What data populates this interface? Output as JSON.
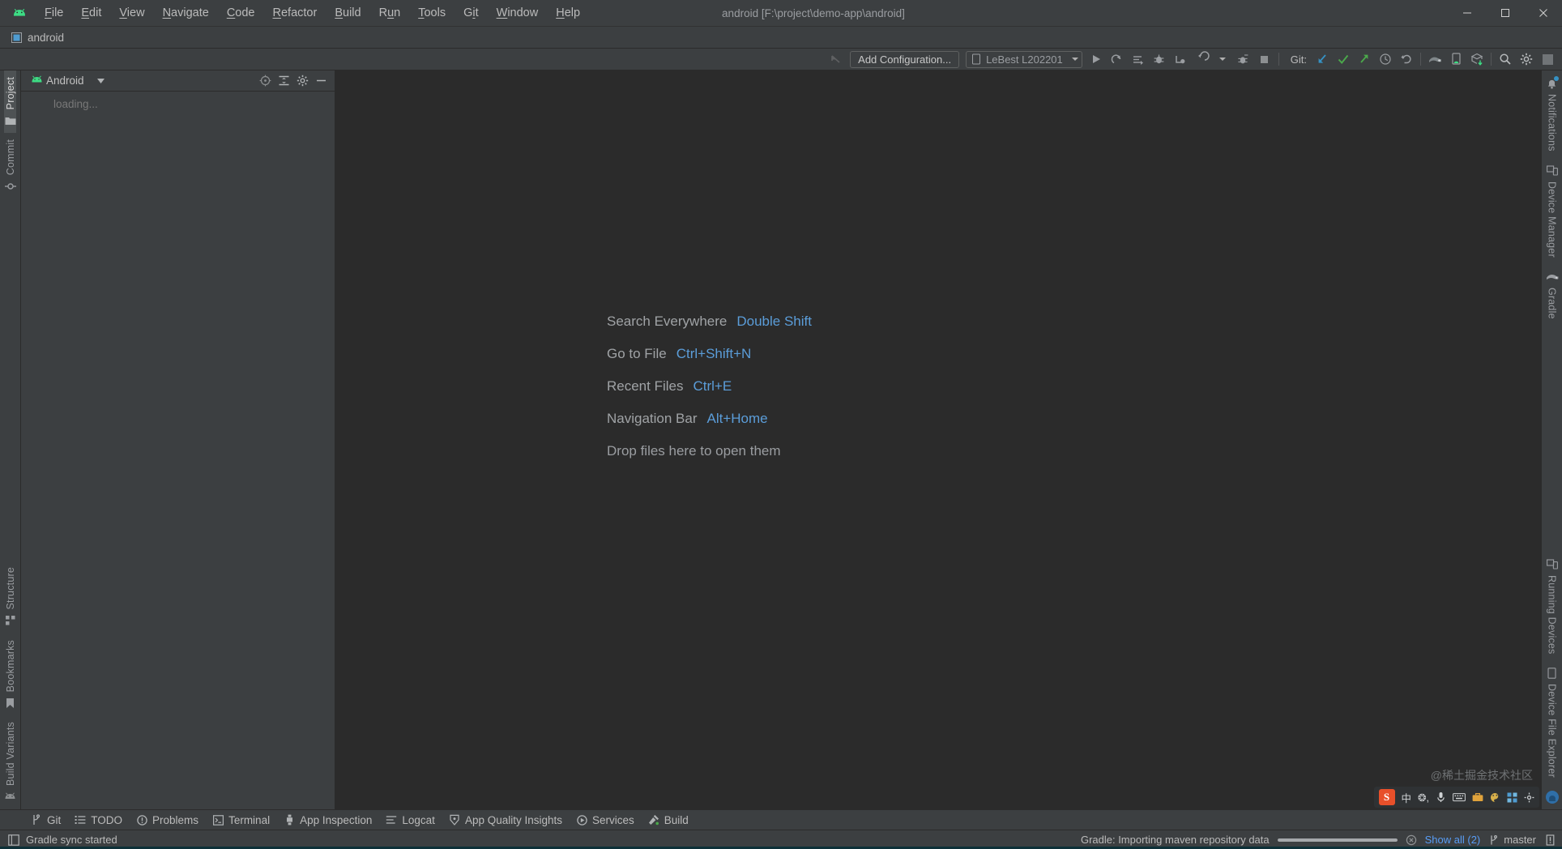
{
  "window": {
    "title": "android [F:\\project\\demo-app\\android]",
    "minimize_label": "─",
    "maximize_label": "❐",
    "close_label": "✕"
  },
  "menubar": {
    "items": [
      {
        "label": "File",
        "mnemonic": "F"
      },
      {
        "label": "Edit",
        "mnemonic": "E"
      },
      {
        "label": "View",
        "mnemonic": "V"
      },
      {
        "label": "Navigate",
        "mnemonic": "N"
      },
      {
        "label": "Code",
        "mnemonic": "C"
      },
      {
        "label": "Refactor",
        "mnemonic": "R"
      },
      {
        "label": "Build",
        "mnemonic": "B"
      },
      {
        "label": "Run",
        "mnemonic": "u"
      },
      {
        "label": "Tools",
        "mnemonic": "T"
      },
      {
        "label": "Git",
        "mnemonic": "i"
      },
      {
        "label": "Window",
        "mnemonic": "W"
      },
      {
        "label": "Help",
        "mnemonic": "H"
      }
    ]
  },
  "navbar": {
    "project_name": "android",
    "project_icon": "module-icon"
  },
  "toolbar": {
    "back_icon": "arrow-up-left-icon",
    "add_configuration": "Add Configuration...",
    "device": "LeBest L202201",
    "device_icon": "phone-icon",
    "git_label": "Git:",
    "run_icon": "run-icon",
    "rerun_icon": "rerun-icon",
    "apply_changes_icon": "apply-changes-icon",
    "debug_icon": "debug-icon",
    "attach_debugger_icon": "attach-debugger-icon",
    "profile_icon": "profiler-icon",
    "profile_dropdown_icon": "chevron-down-icon",
    "coverage_icon": "run-coverage-icon",
    "stop_icon": "stop-icon",
    "git_update_icon": "git-update-icon",
    "git_commit_icon": "git-commit-icon",
    "git_push_icon": "git-push-icon",
    "git_history_icon": "history-icon",
    "undo_icon": "undo-icon",
    "sync_gradle_icon": "gradle-sync-icon",
    "avd_manager_icon": "avd-manager-icon",
    "sdk_manager_icon": "sdk-manager-icon",
    "search_icon": "search-icon",
    "settings_icon": "gear-icon",
    "layout_icon": "layout-icon"
  },
  "left_strip": {
    "top": [
      {
        "label": "Project",
        "icon": "folder-icon",
        "active": true
      },
      {
        "label": "Commit",
        "icon": "commit-icon",
        "active": false
      }
    ],
    "bottom": [
      {
        "label": "Structure",
        "icon": "structure-icon"
      },
      {
        "label": "Bookmarks",
        "icon": "bookmark-icon"
      },
      {
        "label": "Build Variants",
        "icon": "android-icon"
      }
    ]
  },
  "right_strip": {
    "top": [
      {
        "label": "Notifications",
        "icon": "bell-icon",
        "badge": true
      },
      {
        "label": "Device Manager",
        "icon": "device-manager-icon"
      },
      {
        "label": "Gradle",
        "icon": "gradle-elephant-icon"
      }
    ],
    "bottom": [
      {
        "label": "Running Devices",
        "icon": "running-devices-icon"
      },
      {
        "label": "Device File Explorer",
        "icon": "device-file-icon"
      }
    ]
  },
  "project_panel": {
    "title": "Android",
    "title_icon": "android-icon",
    "dropdown_icon": "chevron-down-icon",
    "actions": [
      {
        "name": "select-opened-file-icon",
        "title": "Select Opened File"
      },
      {
        "name": "collapse-all-icon",
        "title": "Collapse All"
      },
      {
        "name": "gear-icon",
        "title": "Options"
      },
      {
        "name": "hide-icon",
        "title": "Hide"
      }
    ],
    "tree_status": "loading..."
  },
  "editor": {
    "hints": [
      {
        "label": "Search Everywhere",
        "key": "Double Shift"
      },
      {
        "label": "Go to File",
        "key": "Ctrl+Shift+N"
      },
      {
        "label": "Recent Files",
        "key": "Ctrl+E"
      },
      {
        "label": "Navigation Bar",
        "key": "Alt+Home"
      }
    ],
    "drop_hint": "Drop files here to open them"
  },
  "ime": {
    "logo_text": "S",
    "items": [
      "中",
      "❂,",
      "mic-icon",
      "keyboard-icon",
      "toolbox-icon",
      "palette-icon",
      "grid-icon",
      "gear-icon"
    ],
    "watermark": "@稀土掘金技术社区"
  },
  "bottom_bar": {
    "tabs": [
      {
        "label": "Git",
        "icon": "git-branch-icon"
      },
      {
        "label": "TODO",
        "icon": "todo-list-icon"
      },
      {
        "label": "Problems",
        "icon": "problems-icon"
      },
      {
        "label": "Terminal",
        "icon": "terminal-icon"
      },
      {
        "label": "App Inspection",
        "icon": "app-inspection-icon"
      },
      {
        "label": "Logcat",
        "icon": "logcat-icon"
      },
      {
        "label": "App Quality Insights",
        "icon": "shield-icon"
      },
      {
        "label": "Services",
        "icon": "services-icon"
      },
      {
        "label": "Build",
        "icon": "build-hammer-icon"
      }
    ]
  },
  "status_bar": {
    "left_icon": "tool-window-icon",
    "message": "Gradle sync started",
    "progress_task": "Gradle: Importing maven repository data",
    "progress_percent": 100,
    "cancel_icon": "cancel-icon",
    "show_all": "Show all (2)",
    "branch": "master",
    "branch_icon": "git-branch-icon",
    "notification_icon": "notification-bell-icon"
  },
  "colors": {
    "window_bg": "#3c3f41",
    "editor_bg": "#2b2b2b",
    "accent_link": "#5b9dd9",
    "accent_blue": "#3592c4",
    "green": "#3ddc84",
    "text": "#bbbbbb"
  }
}
